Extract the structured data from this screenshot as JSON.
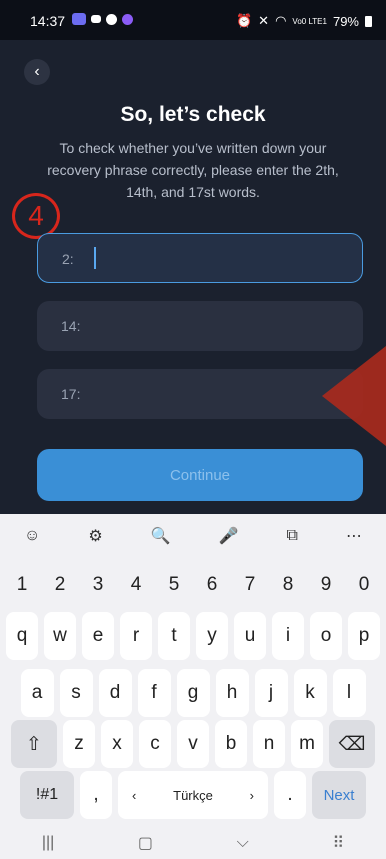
{
  "status_bar": {
    "time": "14:37",
    "battery": "79%",
    "signal_text": "Vo0 LTE1"
  },
  "header": {
    "title": "So, let’s check",
    "subtitle": "To check whether you’ve written down your recovery phrase correctly, please enter the 2th, 14th, and  17st words."
  },
  "annotation": {
    "number": "4"
  },
  "fields": [
    {
      "label": "2:",
      "active": true
    },
    {
      "label": "14:",
      "active": false
    },
    {
      "label": "17:",
      "active": false
    }
  ],
  "continue_label": "Continue",
  "keyboard": {
    "numbers": [
      "1",
      "2",
      "3",
      "4",
      "5",
      "6",
      "7",
      "8",
      "9",
      "0"
    ],
    "row1": [
      "q",
      "w",
      "e",
      "r",
      "t",
      "y",
      "u",
      "i",
      "o",
      "p"
    ],
    "row2": [
      "a",
      "s",
      "d",
      "f",
      "g",
      "h",
      "j",
      "k",
      "l"
    ],
    "row3": [
      "z",
      "x",
      "c",
      "v",
      "b",
      "n",
      "m"
    ],
    "symbols_label": "!#1",
    "comma": ",",
    "left_arrow": "‹",
    "space_label": "Türkçe",
    "right_arrow": "›",
    "period": ".",
    "next_label": "Next",
    "toolbar": [
      "☺",
      "⚙",
      "🔍",
      "🎤",
      "⧉",
      "⋯"
    ],
    "shift": "⇧",
    "backspace": "⌫"
  },
  "nav": [
    "|||",
    "▢",
    "⌵",
    "⠿"
  ],
  "colors": {
    "accent": "#3a8fd6",
    "annotation": "#d7261c",
    "background": "#1b212e"
  }
}
